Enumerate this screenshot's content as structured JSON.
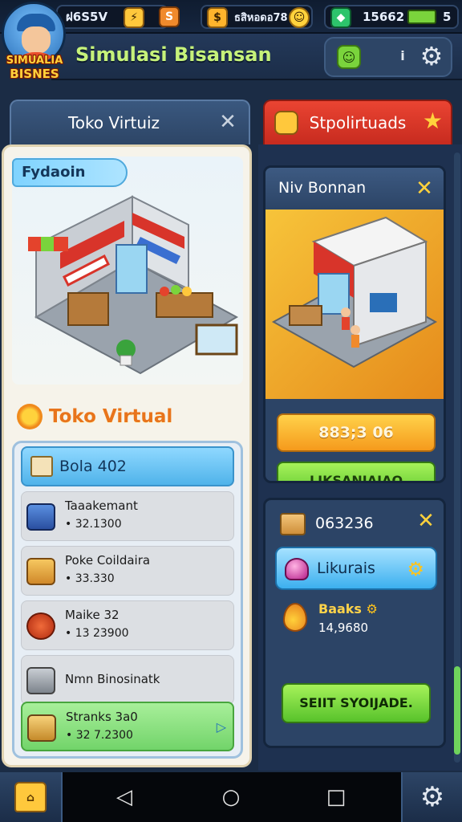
{
  "status_bar": {
    "stat1": "ฝ6S5V",
    "stat2": "ธสิหอดอ78",
    "stat3": "15662",
    "battery": "5"
  },
  "avatar": {
    "badge_line1": "SIMUALIA",
    "badge_line2": "BISNES"
  },
  "header": {
    "title": "Simulasi Bisansan"
  },
  "tabs": {
    "left": "Toko Virtuiz",
    "right": "Stpolirtuads"
  },
  "left_panel": {
    "scene_label": "Fydaoin",
    "section_title": "Toko Virtual",
    "list_header": "Bola 402",
    "items": [
      {
        "name": "Taaakemant",
        "value": "• 32.1300"
      },
      {
        "name": "Poke Coildaira",
        "value": "• 33.330"
      },
      {
        "name": "Maike 32",
        "value": "• 13 23900"
      },
      {
        "name": "Nmn Binosinatk",
        "value": ""
      },
      {
        "name": "Stranks 3a0",
        "value": "• 32 7.2300"
      }
    ]
  },
  "right_panel": {
    "card_title": "Niv Bonnan",
    "orange_button": "883;3 06",
    "green_button": "LIKSANIAIAO",
    "code": "063236",
    "blue_button": "Likurais",
    "reward_label": "Baaks",
    "reward_value": "14,9680",
    "bottom_button": "SEIIT SYOIJADE."
  },
  "colors": {
    "accent_green": "#c6f27a",
    "tab_red": "#ea4432",
    "orange": "#f59a1c",
    "green": "#58c22b",
    "blue": "#3cb0ef"
  }
}
